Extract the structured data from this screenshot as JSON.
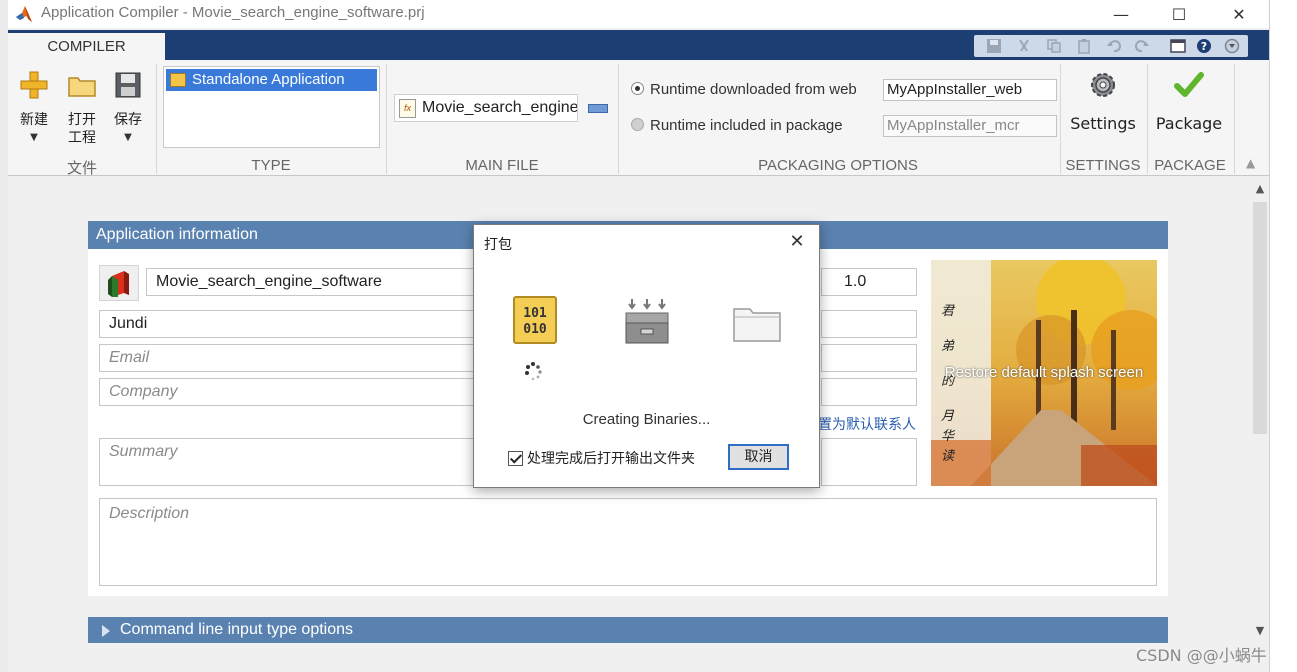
{
  "window": {
    "title": "Application Compiler - Movie_search_engine_software.prj",
    "minimize": "—",
    "maximize": "☐",
    "close": "✕"
  },
  "ribbon": {
    "tab": "COMPILER",
    "file_group": {
      "label": "文件",
      "new_label": "新建",
      "open_label_line1": "打开",
      "open_label_line2": "工程",
      "save_label": "保存",
      "caret": "▼"
    },
    "type_group": {
      "label": "TYPE",
      "selected": "Standalone Application"
    },
    "main_file_group": {
      "label": "MAIN FILE",
      "file": "Movie_search_engine",
      "file_icon_text": "fx"
    },
    "packaging_group": {
      "label": "PACKAGING OPTIONS",
      "option_web": "Runtime downloaded from web",
      "option_web_value": "MyAppInstaller_web",
      "option_pkg": "Runtime included in package",
      "option_pkg_value": "MyAppInstaller_mcr"
    },
    "settings_group": {
      "label": "SETTINGS",
      "button": "Settings"
    },
    "package_group": {
      "label": "PACKAGE",
      "button": "Package"
    },
    "collapse": "▲"
  },
  "app_info": {
    "header": "Application information",
    "name": "Movie_search_engine_software",
    "version": "1.0",
    "author": "Jundi",
    "email_placeholder": "Email",
    "company_placeholder": "Company",
    "set_contact_link": "置为默认联系人",
    "summary_placeholder": "Summary",
    "description_placeholder": "Description",
    "splash_text": "Restore default splash screen",
    "splash_poem": "君弟的月华读"
  },
  "cmd_section": {
    "header": "Command line input type options"
  },
  "scrollbar": {
    "up": "▲",
    "down": "▼"
  },
  "dialog": {
    "title": "打包",
    "close": "✕",
    "binary_icon_line1": "101",
    "binary_icon_line2": "010",
    "status": "Creating Binaries...",
    "checkbox_label": "处理完成后打开输出文件夹",
    "checkbox_checked": true,
    "cancel": "取消"
  },
  "watermark": "CSDN @@小蜗牛",
  "colors": {
    "tab_bar": "#1c3e72",
    "section_header": "#5a82b0",
    "selection": "#3879d9",
    "link": "#2a5db0"
  }
}
